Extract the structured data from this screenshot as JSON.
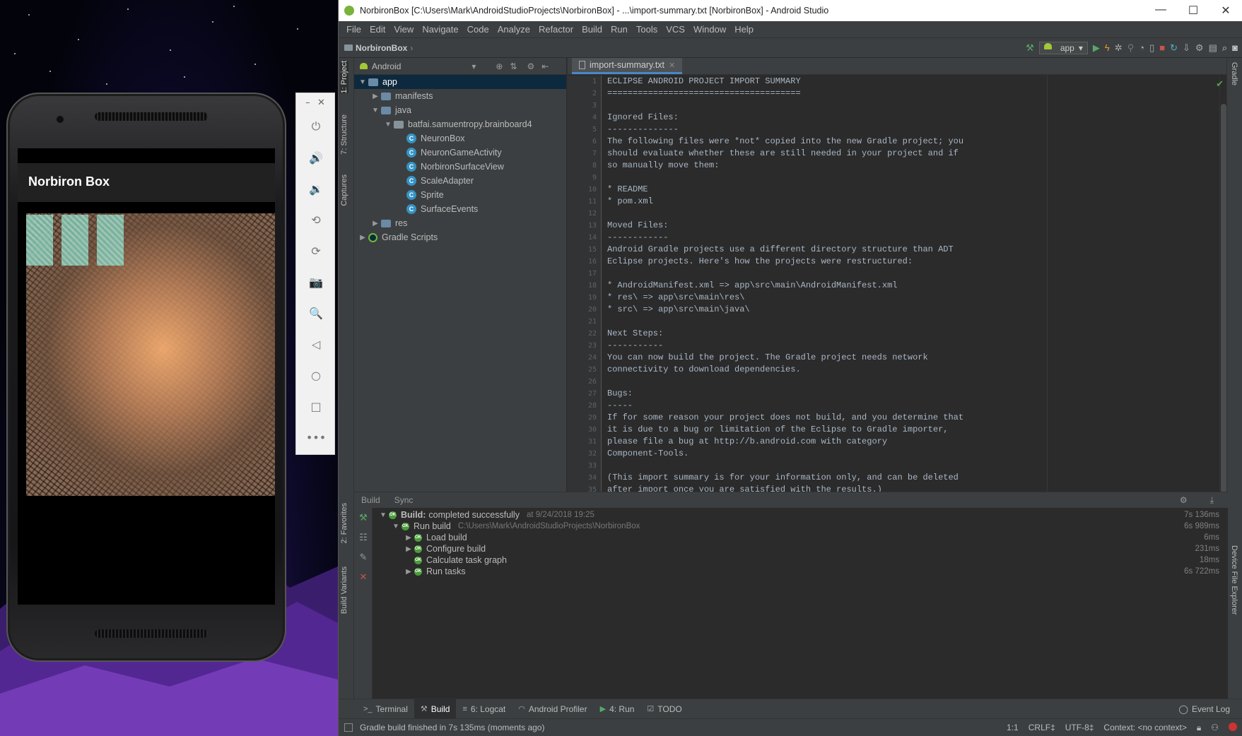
{
  "emulator": {
    "app_title": "Norbiron Box",
    "toolbar_top": {
      "minimize": "–",
      "close": "✕"
    },
    "toolbar_buttons": [
      {
        "icon": "power-icon",
        "glyph": "⏻"
      },
      {
        "icon": "volume-up-icon",
        "glyph": "🔊"
      },
      {
        "icon": "volume-down-icon",
        "glyph": "🔉"
      },
      {
        "icon": "rotate-left-icon",
        "glyph": "⟲"
      },
      {
        "icon": "rotate-right-icon",
        "glyph": "⟳"
      },
      {
        "icon": "camera-icon",
        "glyph": "📷"
      },
      {
        "icon": "zoom-icon",
        "glyph": "🔍"
      },
      {
        "icon": "back-icon",
        "glyph": "◁"
      },
      {
        "icon": "home-icon",
        "glyph": "○"
      },
      {
        "icon": "overview-icon",
        "glyph": "□"
      },
      {
        "icon": "more-icon",
        "glyph": "•••"
      }
    ]
  },
  "window": {
    "title": "NorbironBox [C:\\Users\\Mark\\AndroidStudioProjects\\NorbironBox] - ...\\import-summary.txt [NorbironBox] - Android Studio",
    "controls": {
      "minimize": "—",
      "maximize": "☐",
      "close": "✕"
    }
  },
  "menu": [
    "File",
    "Edit",
    "View",
    "Navigate",
    "Code",
    "Analyze",
    "Refactor",
    "Build",
    "Run",
    "Tools",
    "VCS",
    "Window",
    "Help"
  ],
  "navbar": {
    "project": "NorbironBox",
    "run_config": "app"
  },
  "left_strip": {
    "project": "1: Project",
    "structure": "7: Structure",
    "captures": "Captures",
    "favorites": "2: Favorites",
    "build_variants": "Build Variants"
  },
  "right_strip": {
    "gradle": "Gradle",
    "device_file_explorer": "Device File Explorer"
  },
  "project_panel": {
    "view": "Android",
    "tree": [
      {
        "label": "app",
        "depth": 0,
        "arrow": "▼",
        "icon": "folder",
        "selected": true
      },
      {
        "label": "manifests",
        "depth": 1,
        "arrow": "▶",
        "icon": "folder"
      },
      {
        "label": "java",
        "depth": 1,
        "arrow": "▼",
        "icon": "folder"
      },
      {
        "label": "batfai.samuentropy.brainboard4",
        "depth": 2,
        "arrow": "▼",
        "icon": "pkg"
      },
      {
        "label": "NeuronBox",
        "depth": 3,
        "arrow": "",
        "icon": "cls"
      },
      {
        "label": "NeuronGameActivity",
        "depth": 3,
        "arrow": "",
        "icon": "cls"
      },
      {
        "label": "NorbironSurfaceView",
        "depth": 3,
        "arrow": "",
        "icon": "cls"
      },
      {
        "label": "ScaleAdapter",
        "depth": 3,
        "arrow": "",
        "icon": "cls"
      },
      {
        "label": "Sprite",
        "depth": 3,
        "arrow": "",
        "icon": "cls"
      },
      {
        "label": "SurfaceEvents",
        "depth": 3,
        "arrow": "",
        "icon": "cls"
      },
      {
        "label": "res",
        "depth": 1,
        "arrow": "▶",
        "icon": "folder"
      },
      {
        "label": "Gradle Scripts",
        "depth": 0,
        "arrow": "▶",
        "icon": "gradle"
      }
    ]
  },
  "editor": {
    "tab": "import-summary.txt",
    "lines": [
      "ECLIPSE ANDROID PROJECT IMPORT SUMMARY",
      "======================================",
      "",
      "Ignored Files:",
      "--------------",
      "The following files were *not* copied into the new Gradle project; you",
      "should evaluate whether these are still needed in your project and if",
      "so manually move them:",
      "",
      "* README",
      "* pom.xml",
      "",
      "Moved Files:",
      "------------",
      "Android Gradle projects use a different directory structure than ADT",
      "Eclipse projects. Here's how the projects were restructured:",
      "",
      "* AndroidManifest.xml => app\\src\\main\\AndroidManifest.xml",
      "* res\\ => app\\src\\main\\res\\",
      "* src\\ => app\\src\\main\\java\\",
      "",
      "Next Steps:",
      "-----------",
      "You can now build the project. The Gradle project needs network",
      "connectivity to download dependencies.",
      "",
      "Bugs:",
      "-----",
      "If for some reason your project does not build, and you determine that",
      "it is due to a bug or limitation of the Eclipse to Gradle importer,",
      "please file a bug at http://b.android.com with category",
      "Component-Tools.",
      "",
      "(This import summary is for your information only, and can be deleted",
      "after import once you are satisfied with the results.)"
    ]
  },
  "build_panel": {
    "tabs": [
      "Build",
      "Sync"
    ],
    "rows": [
      {
        "label": "Build:",
        "label2": "completed successfully",
        "extra": "at 9/24/2018 19:25",
        "time": "7s 136ms",
        "depth": 0,
        "arrow": "▼"
      },
      {
        "label": "Run build",
        "extra": "C:\\Users\\Mark\\AndroidStudioProjects\\NorbironBox",
        "time": "6s 989ms",
        "depth": 1,
        "arrow": "▼"
      },
      {
        "label": "Load build",
        "time": "6ms",
        "depth": 2,
        "arrow": "▶"
      },
      {
        "label": "Configure build",
        "time": "231ms",
        "depth": 2,
        "arrow": "▶"
      },
      {
        "label": "Calculate task graph",
        "time": "18ms",
        "depth": 2,
        "arrow": ""
      },
      {
        "label": "Run tasks",
        "time": "6s 722ms",
        "depth": 2,
        "arrow": "▶"
      }
    ]
  },
  "bottom_tabs": [
    {
      "label": "Terminal",
      "icon": "terminal-icon",
      "glyph": ">_"
    },
    {
      "label": "Build",
      "icon": "build-icon",
      "glyph": "⚒",
      "active": true
    },
    {
      "label": "6: Logcat",
      "icon": "logcat-icon",
      "glyph": "≡"
    },
    {
      "label": "Android Profiler",
      "icon": "profiler-icon",
      "glyph": "◠"
    },
    {
      "label": "4: Run",
      "icon": "run-icon",
      "glyph": "▶"
    },
    {
      "label": "TODO",
      "icon": "todo-icon",
      "glyph": "☑"
    }
  ],
  "event_log": "Event Log",
  "status": {
    "message": "Gradle build finished in 7s 135ms (moments ago)",
    "position": "1:1",
    "line_sep": "CRLF‡",
    "encoding": "UTF-8‡",
    "context": "Context: <no context>"
  },
  "colors": {
    "accent": "#4a88c7",
    "success": "#4a9d3a",
    "run_green": "#59a869",
    "stop_red": "#c75450"
  }
}
